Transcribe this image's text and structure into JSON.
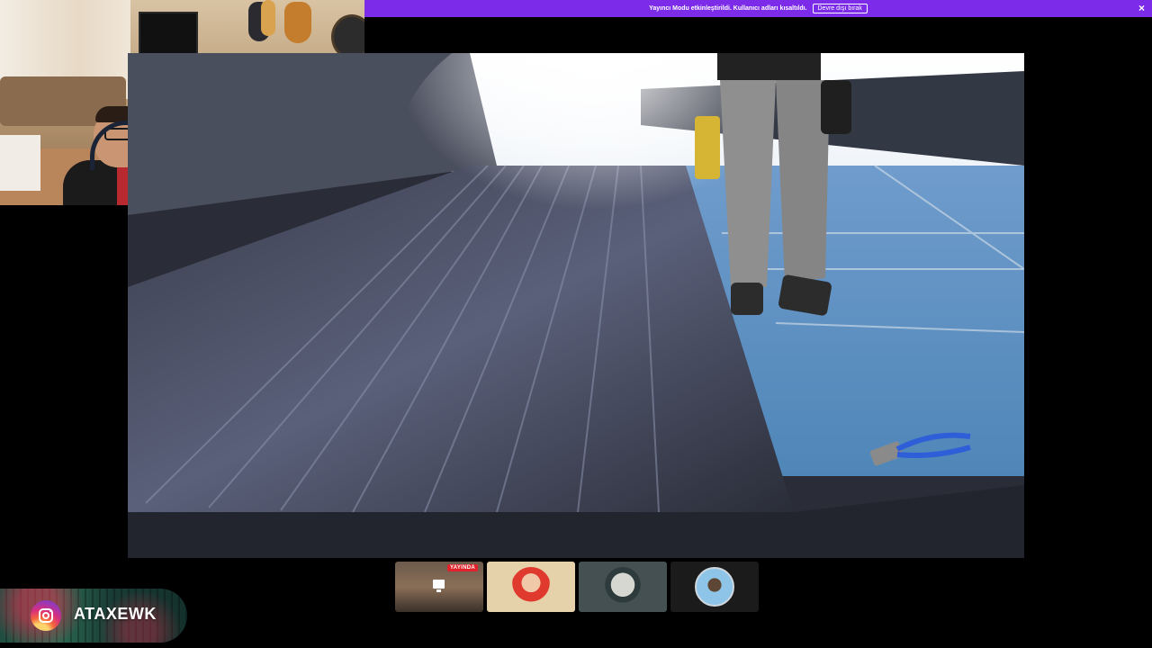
{
  "banner": {
    "message": "Yayıncı Modu etkinleştirildi. Kullanıcı adları kısaltıldı.",
    "disable_button": "Devre dışı bırak",
    "close_icon": "×"
  },
  "thumbnails": {
    "live_badge": "YAYINDA"
  },
  "overlay": {
    "instagram_handle": "ATAXEWK"
  },
  "colors": {
    "banner": "#7c2be8",
    "live": "#e0232a"
  }
}
